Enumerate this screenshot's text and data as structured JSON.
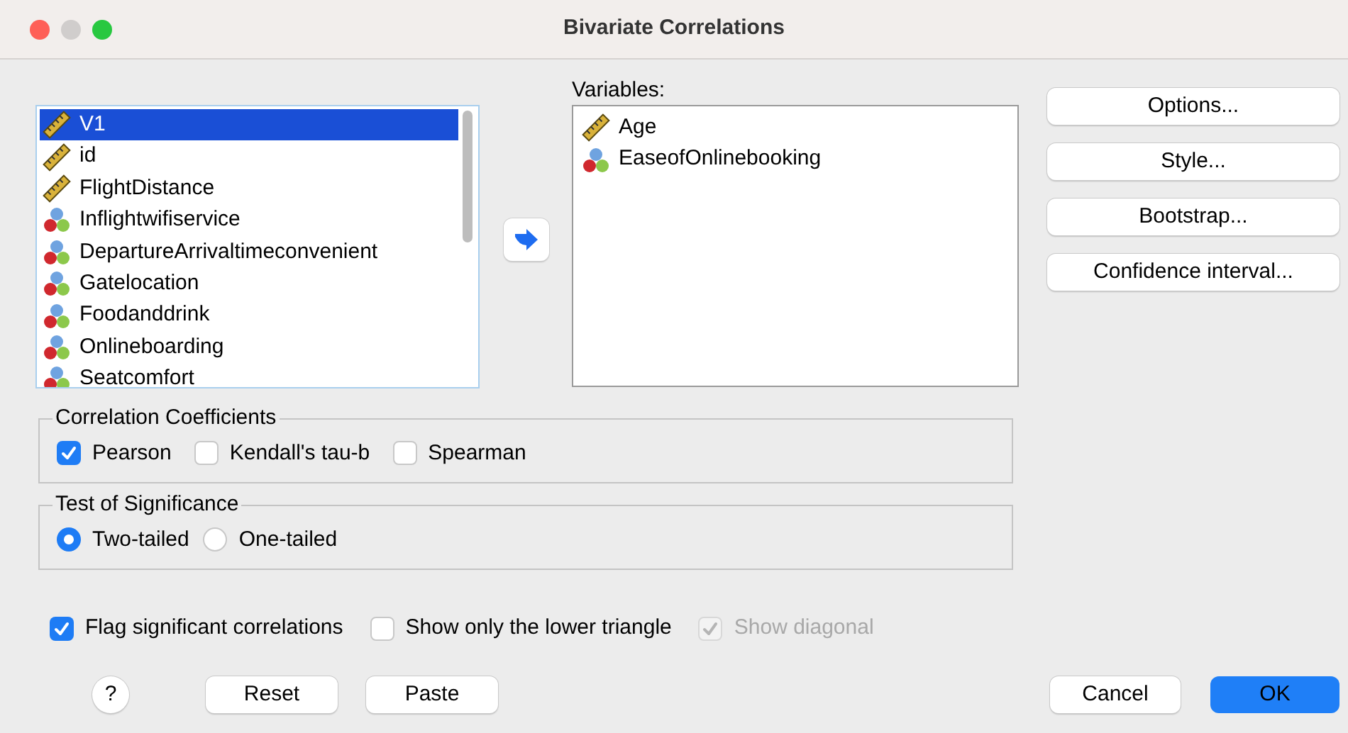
{
  "window": {
    "title": "Bivariate Correlations"
  },
  "source_list": {
    "items": [
      {
        "name": "V1",
        "kind": "scale",
        "selected": true
      },
      {
        "name": "id",
        "kind": "scale",
        "selected": false
      },
      {
        "name": "FlightDistance",
        "kind": "scale",
        "selected": false
      },
      {
        "name": "Inflightwifiservice",
        "kind": "ordinal",
        "selected": false
      },
      {
        "name": "DepartureArrivaltimeconvenient",
        "kind": "ordinal",
        "selected": false
      },
      {
        "name": "Gatelocation",
        "kind": "ordinal",
        "selected": false
      },
      {
        "name": "Foodanddrink",
        "kind": "ordinal",
        "selected": false
      },
      {
        "name": "Onlineboarding",
        "kind": "ordinal",
        "selected": false
      },
      {
        "name": "Seatcomfort",
        "kind": "ordinal",
        "selected": false
      }
    ]
  },
  "variables": {
    "label": "Variables:",
    "items": [
      {
        "name": "Age",
        "kind": "scale",
        "selected": false
      },
      {
        "name": "EaseofOnlinebooking",
        "kind": "ordinal",
        "selected": false
      }
    ]
  },
  "side_buttons": [
    "Options...",
    "Style...",
    "Bootstrap...",
    "Confidence interval..."
  ],
  "correlation_coefficients": {
    "title": "Correlation Coefficients",
    "options": [
      {
        "label": "Pearson",
        "checked": true
      },
      {
        "label": "Kendall's tau-b",
        "checked": false
      },
      {
        "label": "Spearman",
        "checked": false
      }
    ]
  },
  "test_of_significance": {
    "title": "Test of Significance",
    "options": [
      {
        "label": "Two-tailed",
        "selected": true
      },
      {
        "label": "One-tailed",
        "selected": false
      }
    ]
  },
  "flags": [
    {
      "label": "Flag significant correlations",
      "checked": true,
      "disabled": false
    },
    {
      "label": "Show only the lower triangle",
      "checked": false,
      "disabled": false
    },
    {
      "label": "Show diagonal",
      "checked": true,
      "disabled": true
    }
  ],
  "footer": {
    "help": "?",
    "left_buttons": [
      "Reset",
      "Paste"
    ],
    "cancel": "Cancel",
    "ok": "OK"
  }
}
